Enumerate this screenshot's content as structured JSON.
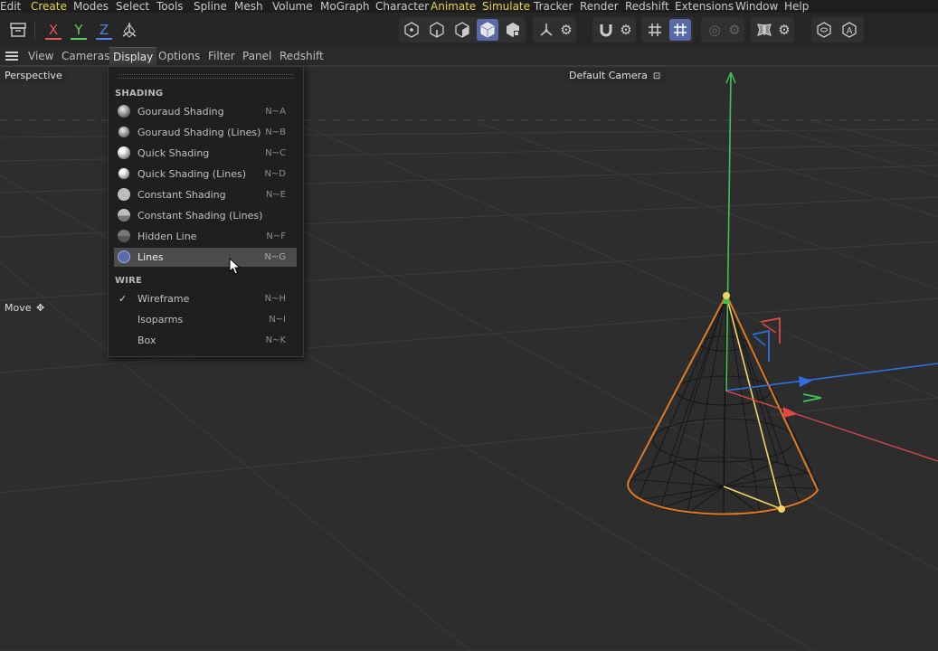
{
  "menubar": [
    "Edit",
    "Create",
    "Modes",
    "Select",
    "Tools",
    "Spline",
    "Mesh",
    "Volume",
    "MoGraph",
    "Character",
    "Animate",
    "Simulate",
    "Tracker",
    "Render",
    "Redshift",
    "Extensions",
    "Window",
    "Help"
  ],
  "menubar_highlighted": [
    "Create",
    "Animate",
    "Simulate"
  ],
  "toolbar": {
    "x_label": "X",
    "y_label": "Y",
    "z_label": "Z"
  },
  "viewbar": {
    "view": "View",
    "cameras": "Cameras",
    "display": "Display",
    "options": "Options",
    "filter": "Filter",
    "panel": "Panel",
    "redshift": "Redshift"
  },
  "viewport": {
    "label": "Perspective",
    "camera": "Default Camera",
    "tool": "Move"
  },
  "display_menu": {
    "shading_header": "SHADING",
    "shading_items": [
      {
        "label": "Gouraud Shading",
        "shortcut": "N~A"
      },
      {
        "label": "Gouraud Shading (Lines)",
        "shortcut": "N~B"
      },
      {
        "label": "Quick Shading",
        "shortcut": "N~C"
      },
      {
        "label": "Quick Shading (Lines)",
        "shortcut": "N~D"
      },
      {
        "label": "Constant Shading",
        "shortcut": "N~E"
      },
      {
        "label": "Constant Shading (Lines)",
        "shortcut": ""
      },
      {
        "label": "Hidden Line",
        "shortcut": "N~F"
      },
      {
        "label": "Lines",
        "shortcut": "N~G"
      }
    ],
    "wire_header": "WIRE",
    "wire_items": [
      {
        "label": "Wireframe",
        "shortcut": "N~H",
        "checked": "✓"
      },
      {
        "label": "Isoparms",
        "shortcut": "N~I"
      },
      {
        "label": "Box",
        "shortcut": "N~K"
      }
    ],
    "highlighted_item": "Lines"
  },
  "colors": {
    "accent": "#5a6aa8",
    "x_axis": "#e04848",
    "y_axis": "#3ec454",
    "z_axis": "#2f6fe0",
    "selection_outline": "#e07a22",
    "menu_highlight_text": "#e8d24a"
  }
}
